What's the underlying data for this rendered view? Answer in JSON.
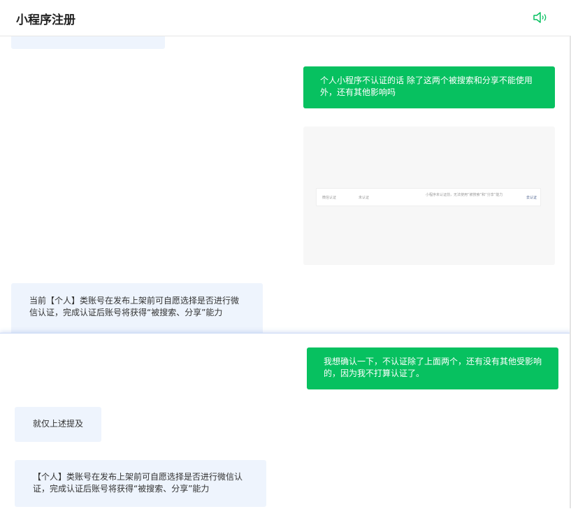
{
  "header": {
    "title": "小程序注册",
    "icon": "speaker-icon"
  },
  "top_chat": {
    "user_message_1": "个人小程序不认证的话 除了这两个被搜索和分享不能使用外，还有其他影响吗",
    "screenshot": {
      "col1": "微信认证",
      "col2": "未认证",
      "col3": "小程序未认证前，无法使用“被搜索”和“分享”能力",
      "col4": "去认证"
    },
    "bot_message_1": "当前【个人】类账号在发布上架前可自愿选择是否进行微信认证，完成认证后账号将获得“被搜索、分享”能力"
  },
  "bottom_chat": {
    "user_message_2": "我想确认一下，不认证除了上面两个，还有没有其他受影响的，因为我不打算认证了。",
    "bot_message_2": "就仅上述提及",
    "bot_message_3": "【个人】类账号在发布上架前可自愿选择是否进行微信认证，完成认证后账号将获得“被搜索、分享”能力"
  },
  "colors": {
    "user_bubble": "#07c160",
    "bot_bubble": "#eef4fd"
  }
}
